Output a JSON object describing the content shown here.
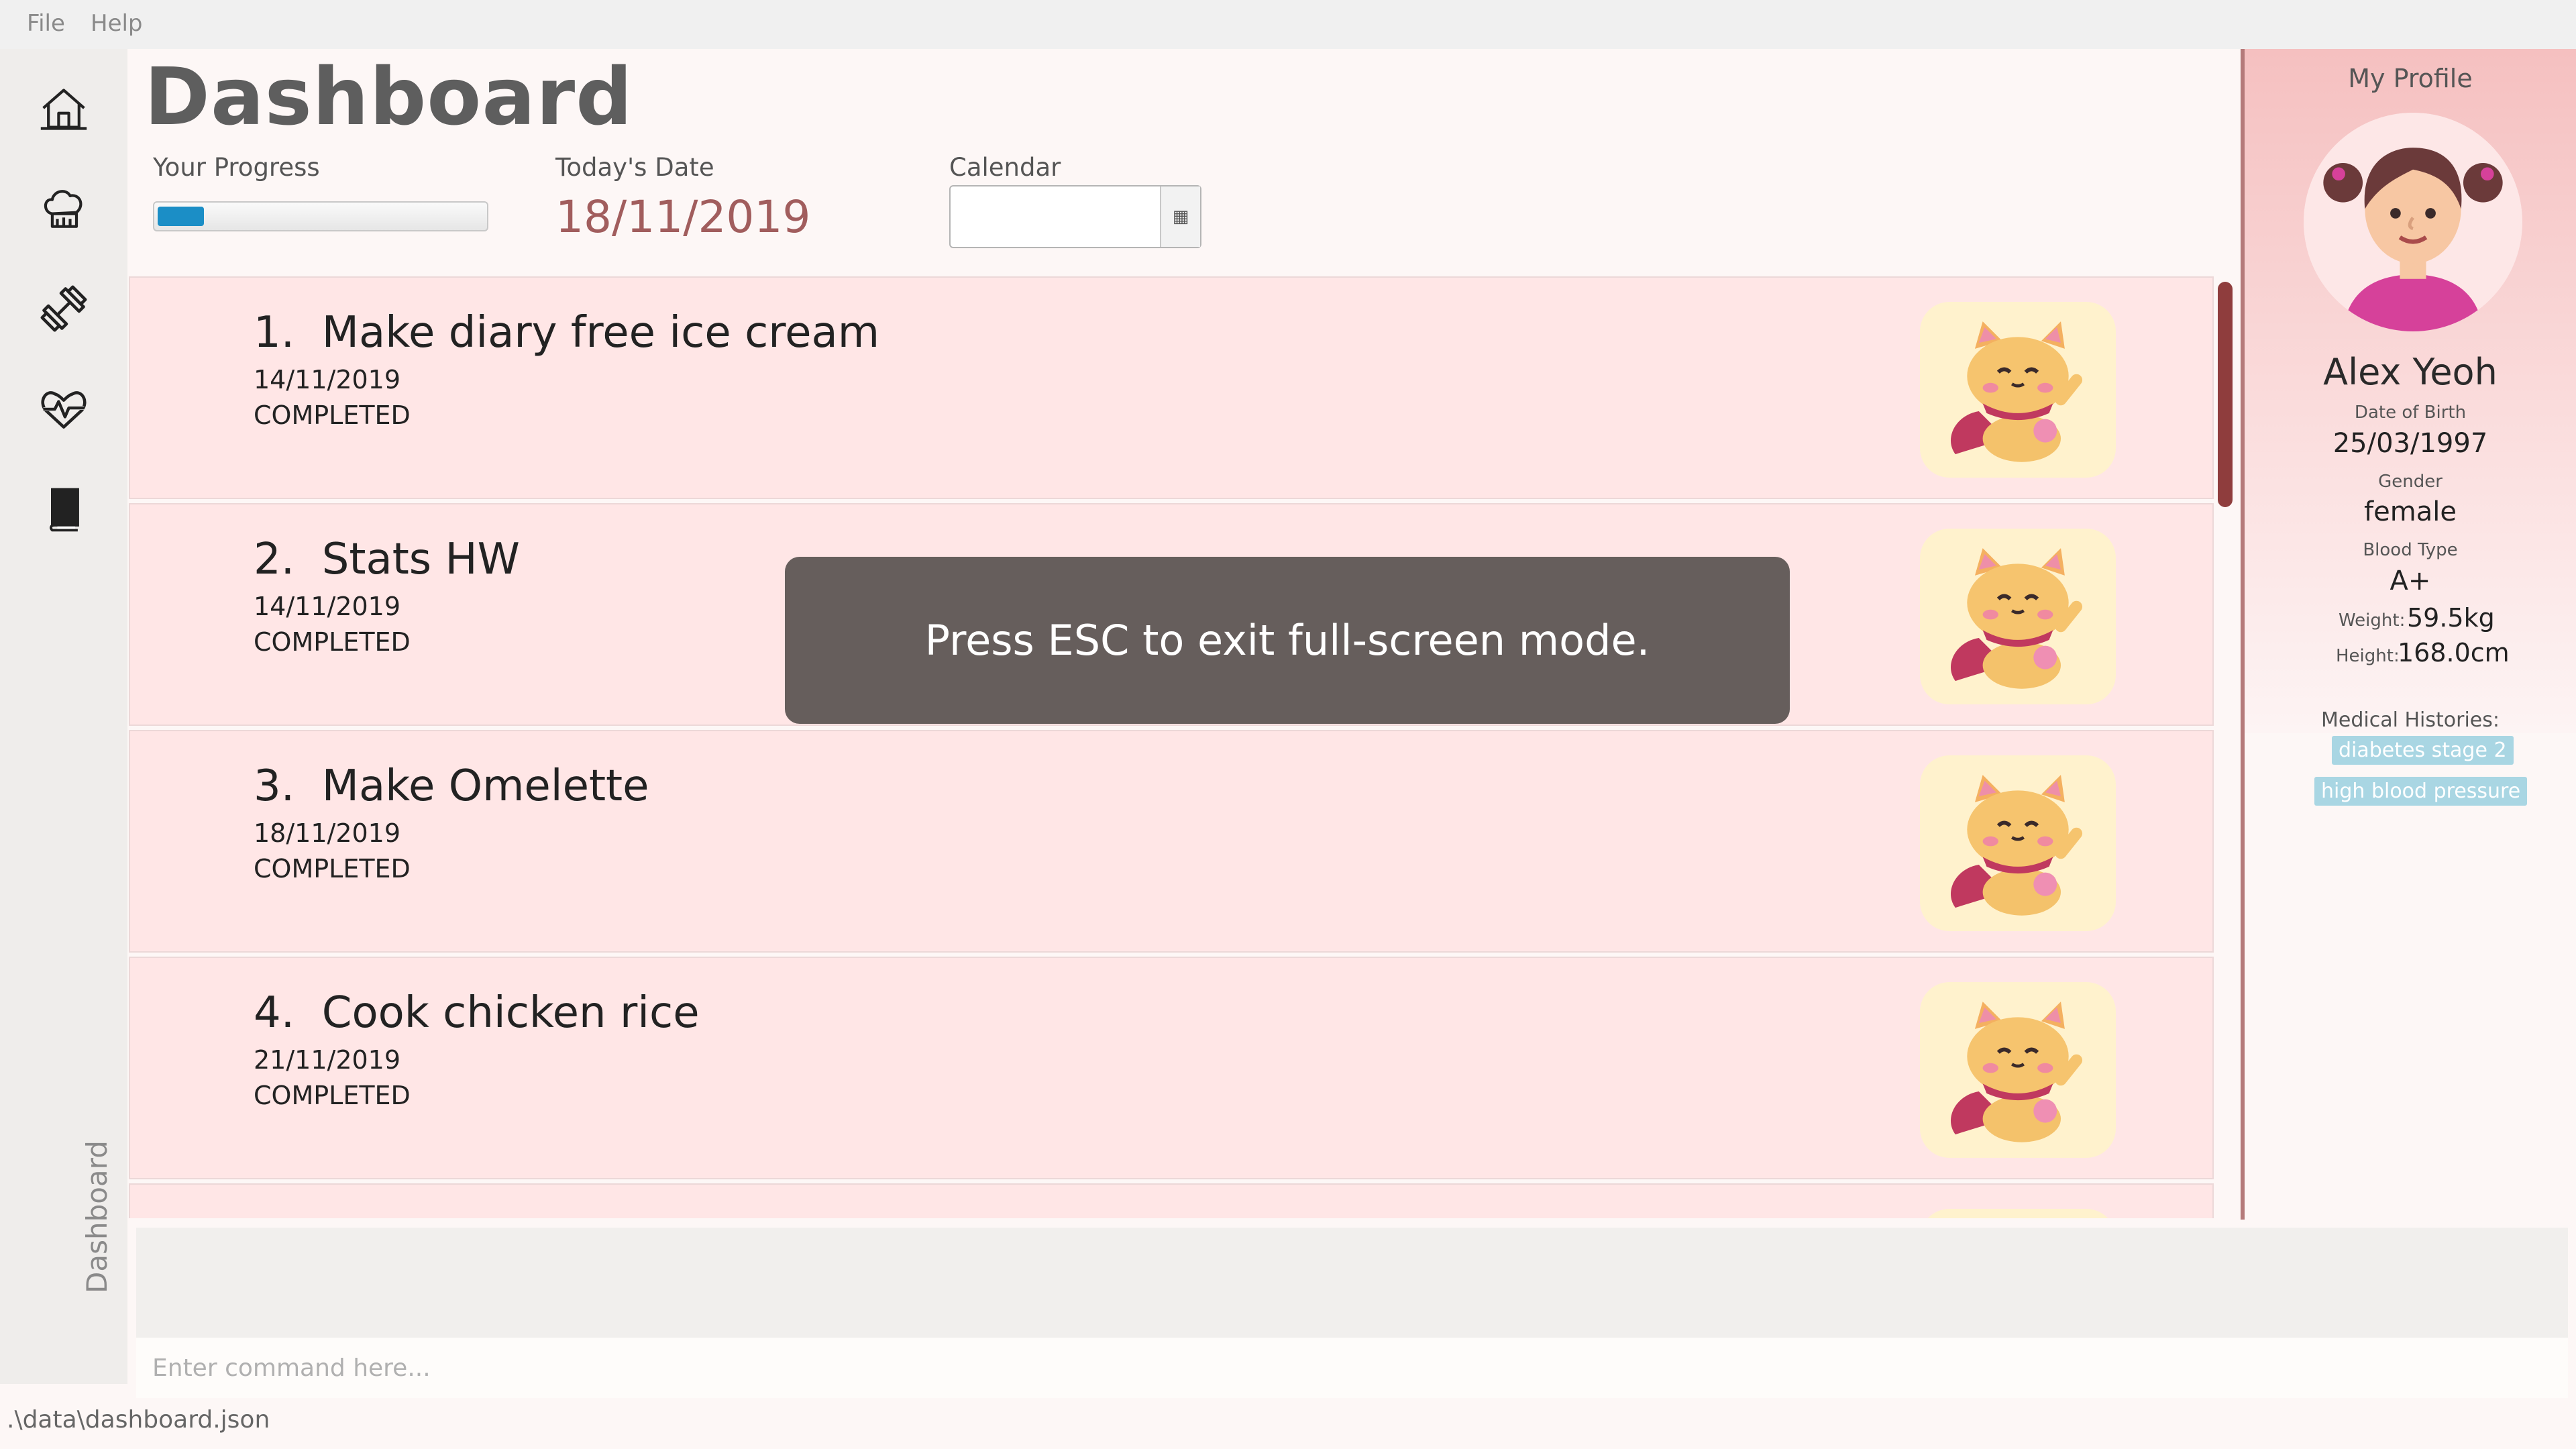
{
  "menu": {
    "file": "File",
    "help": "Help"
  },
  "nav": [
    {
      "name": "home-icon"
    },
    {
      "name": "chef-hat-icon"
    },
    {
      "name": "dumbbell-icon"
    },
    {
      "name": "heartbeat-icon"
    },
    {
      "name": "book-icon"
    }
  ],
  "sidebar_label": "Dashboard",
  "header": {
    "title": "Dashboard",
    "progress_label": "Your Progress",
    "progress_fraction": 0.14,
    "today_label": "Today's Date",
    "today_value": "18/11/2019",
    "calendar_label": "Calendar",
    "calendar_value": ""
  },
  "tasks": [
    {
      "number": "1.",
      "title": "Make diary free ice cream",
      "date": "14/11/2019",
      "status": "COMPLETED"
    },
    {
      "number": "2.",
      "title": "Stats HW",
      "date": "14/11/2019",
      "status": "COMPLETED"
    },
    {
      "number": "3.",
      "title": "Make Omelette",
      "date": "18/11/2019",
      "status": "COMPLETED"
    },
    {
      "number": "4.",
      "title": "Cook chicken rice",
      "date": "21/11/2019",
      "status": "COMPLETED"
    }
  ],
  "toast": "Press ESC to exit full-screen mode.",
  "profile": {
    "title": "My Profile",
    "name": "Alex Yeoh",
    "dob_label": "Date of Birth",
    "dob": "25/03/1997",
    "gender_label": "Gender",
    "gender": "female",
    "blood_label": "Blood Type",
    "blood": "A+",
    "weight_label": "Weight:",
    "weight": "59.5kg",
    "height_label": "Height:",
    "height": "168.0cm",
    "histories_label": "Medical Histories:",
    "histories": [
      "diabetes stage 2",
      "high blood pressure"
    ]
  },
  "command": {
    "placeholder": "Enter command here...",
    "result": ""
  },
  "status_bar": ".\\data\\dashboard.json",
  "colors": {
    "accent": "#1b8ec6",
    "card": "#ffe6e6",
    "date": "#a15d5d",
    "toast": "#665e5c",
    "tag": "#a9d6e3"
  }
}
